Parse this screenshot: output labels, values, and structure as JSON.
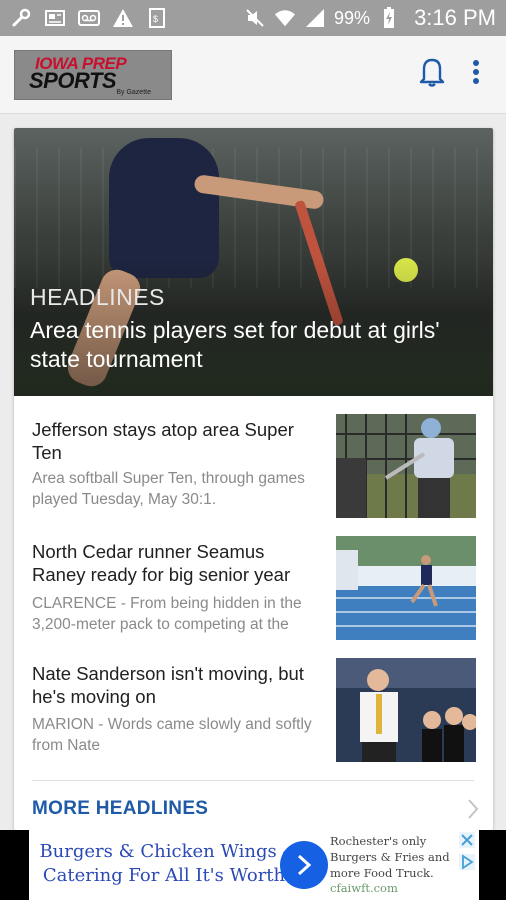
{
  "status_bar": {
    "battery": "99%",
    "time": "3:16 PM",
    "icons": [
      "wrench-icon",
      "newspaper-icon",
      "voicemail-icon",
      "warning-icon",
      "phone-rate-icon",
      "mute-icon",
      "wifi-icon",
      "signal-icon",
      "battery-charging-icon"
    ]
  },
  "app_bar": {
    "logo_text_top": "IOWA PREP",
    "logo_text_main": "SPORTS",
    "logo_byline": "By Gazette",
    "notification_icon": "bell-icon",
    "menu_icon": "more-vert-icon"
  },
  "hero": {
    "kicker": "HEADLINES",
    "title": "Area tennis players set for debut at girls' state tournament"
  },
  "stories": [
    {
      "title": "Jefferson stays atop area Super Ten",
      "summary": "Area softball Super Ten, through games played Tuesday, May 30:1."
    },
    {
      "title": "North Cedar runner Seamus Raney ready for big senior year",
      "summary": "CLARENCE - From being hidden in the 3,200-meter pack to competing at the"
    },
    {
      "title": "Nate Sanderson isn't moving, but he's moving on",
      "summary": "MARION - Words came slowly and softly from Nate"
    }
  ],
  "more_link": "MORE HEADLINES",
  "ad": {
    "headline_line1": "Burgers & Chicken Wings -",
    "headline_line2": "Catering For All It's Worth",
    "description": "Rochester's only Burgers & Fries and more Food Truck.",
    "url": "cfaiwft.com",
    "colors": {
      "headline": "#2b49b5",
      "button": "#1560e3"
    }
  },
  "colors": {
    "accent": "#1e5aa8",
    "status_bar": "#9e9e9e"
  }
}
